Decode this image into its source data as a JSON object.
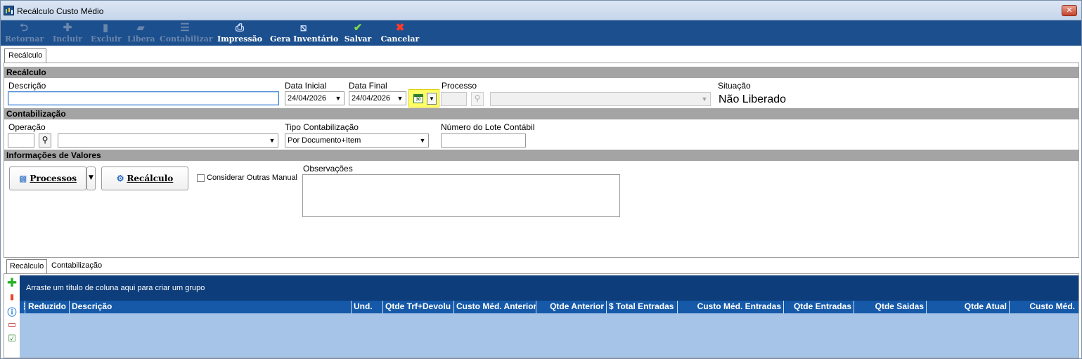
{
  "window": {
    "title": "Recálculo Custo Médio",
    "close_glyph": "✕"
  },
  "toolbar": {
    "items": [
      {
        "label": "Retornar",
        "icon": "undo-arrow-icon",
        "glyph": "⮌",
        "enabled": false
      },
      {
        "label": "Incluir",
        "icon": "plus-icon",
        "glyph": "✚",
        "enabled": false
      },
      {
        "label": "Excluir",
        "icon": "trash-icon",
        "glyph": "▮",
        "enabled": false
      },
      {
        "label": "Libera",
        "icon": "document-icon",
        "glyph": "▰",
        "enabled": false
      },
      {
        "label": "Contabilizar",
        "icon": "list-icon",
        "glyph": "☰",
        "enabled": false
      },
      {
        "label": "Impressão",
        "icon": "printer-icon",
        "glyph": "⎙",
        "enabled": true
      },
      {
        "label": "Gera Inventário",
        "icon": "edit-document-icon",
        "glyph": "⧅",
        "enabled": true
      },
      {
        "label": "Salvar",
        "icon": "check-icon",
        "glyph": "✔",
        "enabled": true
      },
      {
        "label": "Cancelar",
        "icon": "x-icon",
        "glyph": "✖",
        "enabled": true
      }
    ]
  },
  "top_tab": {
    "label": "Recálculo"
  },
  "recalculo": {
    "section_title": "Recálculo",
    "descricao_label": "Descrição",
    "descricao_value": "",
    "data_inicial_label": "Data Inicial",
    "data_inicial_value": "24/04/2026",
    "data_final_label": "Data Final",
    "data_final_value": "24/04/2026",
    "processo_label": "Processo",
    "processo_code": "",
    "processo_value": "",
    "situacao_label": "Situação",
    "situacao_value": "Não Liberado",
    "calendar_icon_text": "30"
  },
  "contabilizacao": {
    "section_title": "Contabilização",
    "operacao_label": "Operação",
    "operacao_code": "",
    "operacao_value": "",
    "tipo_label": "Tipo Contabilização",
    "tipo_value": "Por Documento+Item",
    "lote_label": "Número do Lote Contábil",
    "lote_value": ""
  },
  "valores": {
    "section_title": "Informações de Valores",
    "processos_button": "Processos",
    "recalculo_button": "Recálculo",
    "considerar_label": "Considerar Outras Manual",
    "considerar_checked": false,
    "observacoes_label": "Observações",
    "observacoes_value": ""
  },
  "bottom_tabs": [
    {
      "label": "Recálculo",
      "active": true
    },
    {
      "label": "Contabilização",
      "active": false
    }
  ],
  "grid": {
    "group_hint": "Arraste um título de coluna aqui para criar um grupo",
    "columns": [
      "Reduzido",
      "Descrição",
      "Und.",
      "Qtde Trf+Devolu",
      "Custo Méd. Anterior",
      "Qtde Anterior",
      "$ Total Entradas",
      "Custo Méd. Entradas",
      "Qtde Entradas",
      "Qtde Saidas",
      "Qtde Atual",
      "Custo Méd."
    ],
    "rows": []
  },
  "colors": {
    "toolbar_bg": "#1c4f8d",
    "section_bar": "#a4a4a4",
    "grid_header": "#1559a8",
    "grid_body": "#a6c4e7",
    "highlight": "#ffff66"
  }
}
